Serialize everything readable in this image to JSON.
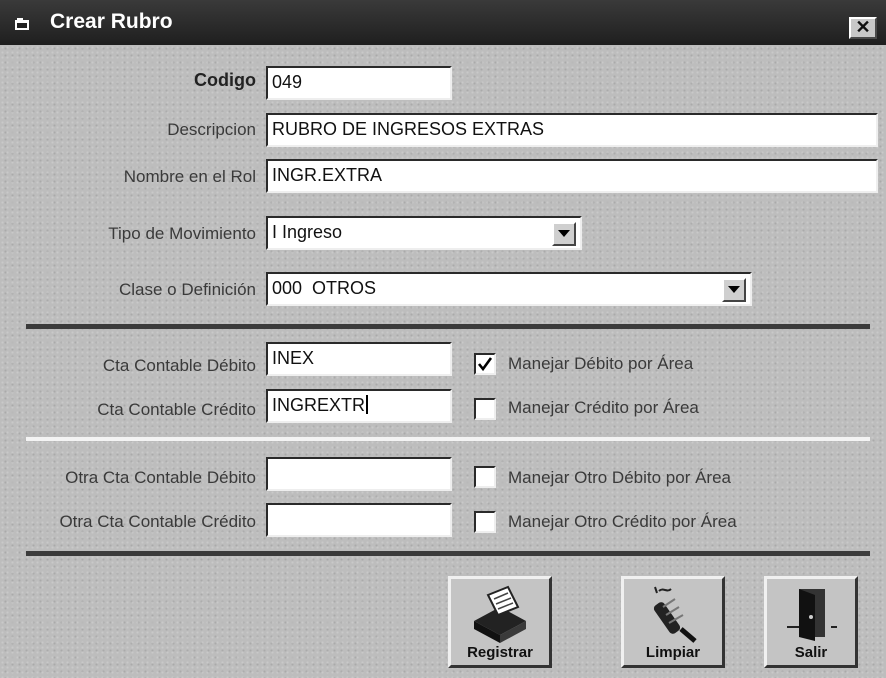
{
  "window": {
    "title": "Crear Rubro",
    "close_glyph": "✕"
  },
  "form": {
    "codigo": {
      "label": "Codigo",
      "value": "049"
    },
    "descripcion": {
      "label": "Descripcion",
      "value": "RUBRO DE INGRESOS EXTRAS"
    },
    "nombre_rol": {
      "label": "Nombre en el Rol",
      "value": "INGR.EXTRA"
    },
    "tipo_movimiento": {
      "label": "Tipo de Movimiento",
      "value": "I Ingreso"
    },
    "clase_definicion": {
      "label": "Clase o Definición",
      "value": "000  OTROS"
    }
  },
  "cuentas": {
    "debito": {
      "label": "Cta Contable Débito",
      "value": "INEX"
    },
    "credito": {
      "label": "Cta Contable Crédito",
      "value": "INGREXTR"
    },
    "manejar_debito": {
      "label": "Manejar Débito por Área",
      "checked": true
    },
    "manejar_credito": {
      "label": "Manejar Crédito por Área",
      "checked": false
    }
  },
  "otras_cuentas": {
    "debito": {
      "label": "Otra Cta Contable Débito",
      "value": ""
    },
    "credito": {
      "label": "Otra Cta Contable Crédito",
      "value": ""
    },
    "manejar_debito": {
      "label": "Manejar Otro Débito por Área",
      "checked": false
    },
    "manejar_credito": {
      "label": "Manejar Otro Crédito por Área",
      "checked": false
    }
  },
  "buttons": {
    "registrar": {
      "label": "Registrar",
      "icon": "card-file-icon"
    },
    "limpiar": {
      "label": "Limpiar",
      "icon": "broom-icon"
    },
    "salir": {
      "label": "Salir",
      "icon": "door-exit-icon"
    }
  }
}
